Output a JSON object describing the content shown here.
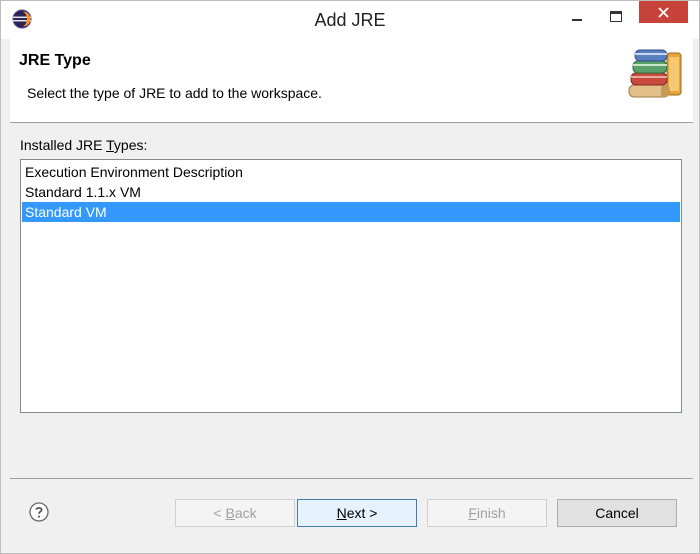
{
  "window": {
    "title": "Add JRE",
    "icon": "eclipse-icon",
    "controls": [
      "minimize-icon",
      "maximize-icon",
      "close-icon"
    ]
  },
  "header": {
    "title": "JRE Type",
    "description": "Select the type of JRE to add to the workspace.",
    "icon": "library-books-icon"
  },
  "list": {
    "label_prefix": "Installed JRE ",
    "label_mnemonic": "T",
    "label_suffix": "ypes:",
    "items": [
      {
        "label": "Execution Environment Description",
        "selected": false
      },
      {
        "label": "Standard 1.1.x VM",
        "selected": false
      },
      {
        "label": "Standard VM",
        "selected": true
      }
    ]
  },
  "footer": {
    "help_icon": "help-icon",
    "buttons": {
      "back_prefix": "< ",
      "back_mnemonic": "B",
      "back_suffix": "ack",
      "next_mnemonic": "N",
      "next_suffix": "ext >",
      "finish_mnemonic": "F",
      "finish_suffix": "inish",
      "cancel": "Cancel"
    },
    "button_states": {
      "back": "disabled",
      "next": "default",
      "finish": "disabled",
      "cancel": "enabled"
    }
  },
  "colors": {
    "selection": "#3399ff",
    "close_button": "#c7433a",
    "window_bg": "#f0f0f0"
  }
}
